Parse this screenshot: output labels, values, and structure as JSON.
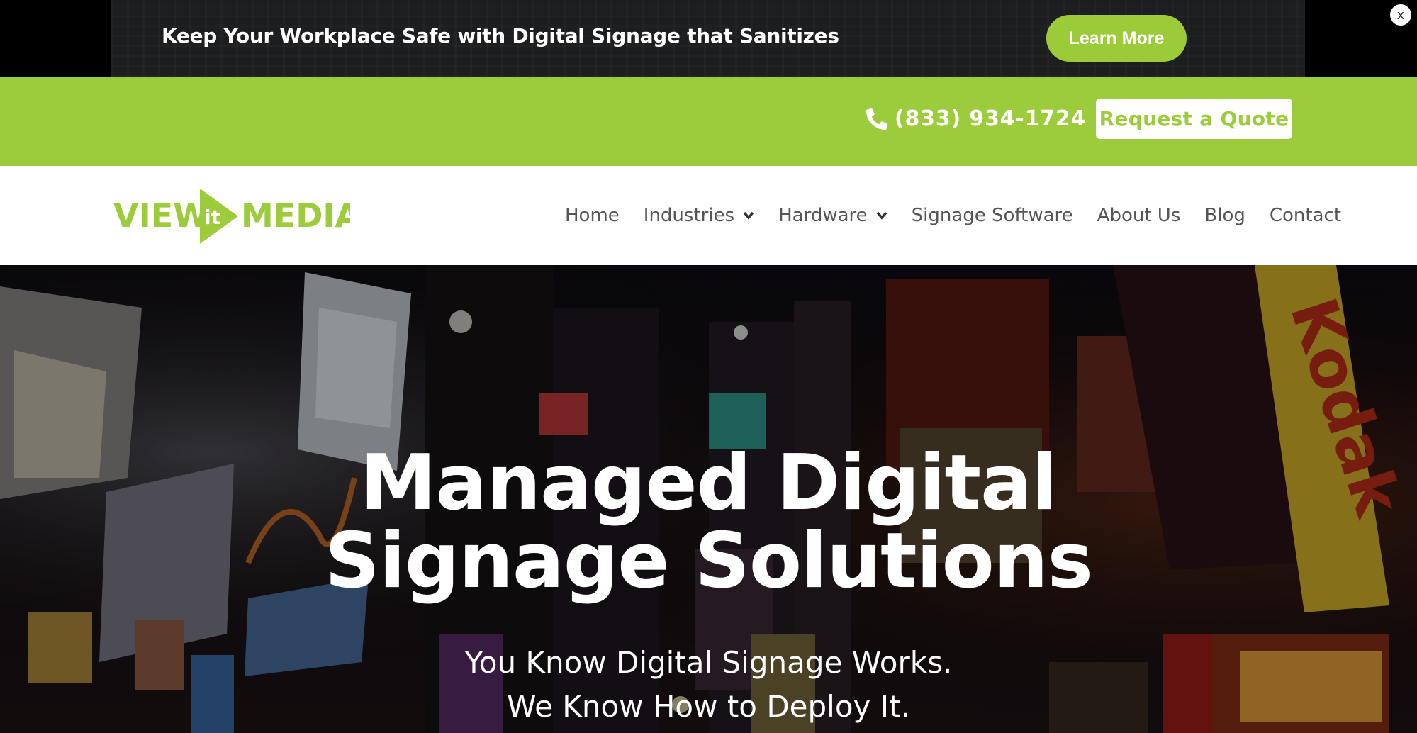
{
  "announcement": {
    "text": "Keep Your Workplace Safe with Digital Signage that Sanitizes",
    "button_label": "Learn More",
    "close_label": "x"
  },
  "contact_bar": {
    "phone": "(833) 934-1724",
    "phone_icon": "phone-icon",
    "quote_button": "Request a Quote"
  },
  "header": {
    "logo": {
      "left": "VIEW",
      "mid": "it",
      "right": "MEDIA"
    },
    "nav": [
      {
        "label": "Home",
        "has_dropdown": false
      },
      {
        "label": "Industries",
        "has_dropdown": true
      },
      {
        "label": "Hardware",
        "has_dropdown": true
      },
      {
        "label": "Signage Software",
        "has_dropdown": false
      },
      {
        "label": "About Us",
        "has_dropdown": false
      },
      {
        "label": "Blog",
        "has_dropdown": false
      },
      {
        "label": "Contact",
        "has_dropdown": false
      }
    ]
  },
  "hero": {
    "title_line1": "Managed Digital",
    "title_line2": "Signage Solutions",
    "subtitle_line1": "You Know Digital Signage Works.",
    "subtitle_line2": "We Know How to Deploy It."
  },
  "colors": {
    "brand_green": "#9ccb3b",
    "announcement_bg": "#1d1e20",
    "nav_text": "#555555"
  }
}
